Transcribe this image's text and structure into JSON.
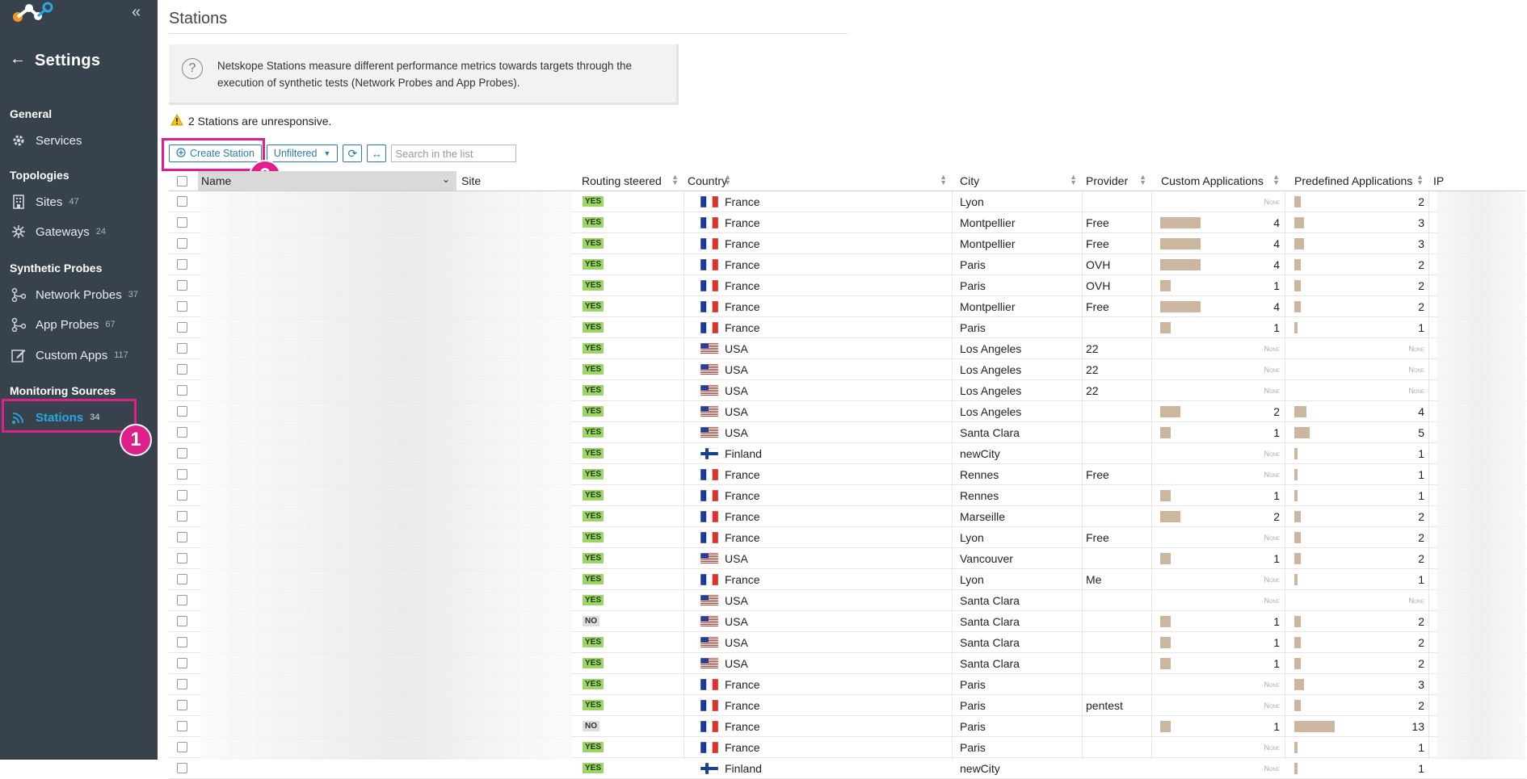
{
  "sidebar": {
    "title": "Settings",
    "sections": [
      {
        "label": "General"
      },
      {
        "label": "Topologies"
      },
      {
        "label": "Synthetic Probes"
      },
      {
        "label": "Monitoring Sources"
      }
    ],
    "items": [
      {
        "label": "Services",
        "count": "",
        "icon": "gear-icon"
      },
      {
        "label": "Sites",
        "count": "47",
        "icon": "building-icon"
      },
      {
        "label": "Gateways",
        "count": "24",
        "icon": "gateway-icon"
      },
      {
        "label": "Network Probes",
        "count": "37",
        "icon": "network-icon"
      },
      {
        "label": "App Probes",
        "count": "67",
        "icon": "network-icon"
      },
      {
        "label": "Custom Apps",
        "count": "117",
        "icon": "edit-icon"
      },
      {
        "label": "Stations",
        "count": "34",
        "icon": "wifi-icon"
      }
    ],
    "annotation_1": "1"
  },
  "page": {
    "title": "Stations",
    "info": "Netskope Stations measure different performance metrics towards targets through the execution of synthetic tests (Network Probes and App Probes).",
    "warning": "2 Stations are unresponsive."
  },
  "toolbar": {
    "create_label": "Create Station",
    "filter_label": "Unfiltered",
    "search_placeholder": "Search in the list",
    "annotation_2": "2"
  },
  "table": {
    "columns": [
      "Name",
      "Site",
      "Routing steered",
      "Country",
      "City",
      "Provider",
      "Custom Applications",
      "Predefined Applications",
      "IP"
    ],
    "none_label": "None",
    "rows": [
      {
        "routing": "YES",
        "country": "France",
        "city": "Lyon",
        "provider": "",
        "custom": null,
        "predefined": 2
      },
      {
        "routing": "YES",
        "country": "France",
        "city": "Montpellier",
        "provider": "Free",
        "custom": 4,
        "predefined": 3
      },
      {
        "routing": "YES",
        "country": "France",
        "city": "Montpellier",
        "provider": "Free",
        "custom": 4,
        "predefined": 3
      },
      {
        "routing": "YES",
        "country": "France",
        "city": "Paris",
        "provider": "OVH",
        "custom": 4,
        "predefined": 2
      },
      {
        "routing": "YES",
        "country": "France",
        "city": "Paris",
        "provider": "OVH",
        "custom": 1,
        "predefined": 2
      },
      {
        "routing": "YES",
        "country": "France",
        "city": "Montpellier",
        "provider": "Free",
        "custom": 4,
        "predefined": 2
      },
      {
        "routing": "YES",
        "country": "France",
        "city": "Paris",
        "provider": "",
        "custom": 1,
        "predefined": 1
      },
      {
        "routing": "YES",
        "country": "USA",
        "city": "Los Angeles",
        "provider": "22",
        "custom": null,
        "predefined": null
      },
      {
        "routing": "YES",
        "country": "USA",
        "city": "Los Angeles",
        "provider": "22",
        "custom": null,
        "predefined": null
      },
      {
        "routing": "YES",
        "country": "USA",
        "city": "Los Angeles",
        "provider": "22",
        "custom": null,
        "predefined": null
      },
      {
        "routing": "YES",
        "country": "USA",
        "city": "Los Angeles",
        "provider": "",
        "custom": 2,
        "predefined": 4
      },
      {
        "routing": "YES",
        "country": "USA",
        "city": "Santa Clara",
        "provider": "",
        "custom": 1,
        "predefined": 5
      },
      {
        "routing": "YES",
        "country": "Finland",
        "city": "newCity",
        "provider": "",
        "custom": null,
        "predefined": 1
      },
      {
        "routing": "YES",
        "country": "France",
        "city": "Rennes",
        "provider": "Free",
        "custom": null,
        "predefined": 1
      },
      {
        "routing": "YES",
        "country": "France",
        "city": "Rennes",
        "provider": "",
        "custom": 1,
        "predefined": 1
      },
      {
        "routing": "YES",
        "country": "France",
        "city": "Marseille",
        "provider": "",
        "custom": 2,
        "predefined": 2
      },
      {
        "routing": "YES",
        "country": "France",
        "city": "Lyon",
        "provider": "Free",
        "custom": null,
        "predefined": 2
      },
      {
        "routing": "YES",
        "country": "USA",
        "city": "Vancouver",
        "provider": "",
        "custom": 1,
        "predefined": 2
      },
      {
        "routing": "YES",
        "country": "France",
        "city": "Lyon",
        "provider": "Me",
        "custom": null,
        "predefined": 1
      },
      {
        "routing": "YES",
        "country": "USA",
        "city": "Santa Clara",
        "provider": "",
        "custom": null,
        "predefined": null
      },
      {
        "routing": "NO",
        "country": "USA",
        "city": "Santa Clara",
        "provider": "",
        "custom": 1,
        "predefined": 2
      },
      {
        "routing": "YES",
        "country": "USA",
        "city": "Santa Clara",
        "provider": "",
        "custom": 1,
        "predefined": 2
      },
      {
        "routing": "YES",
        "country": "USA",
        "city": "Santa Clara",
        "provider": "",
        "custom": 1,
        "predefined": 2
      },
      {
        "routing": "YES",
        "country": "France",
        "city": "Paris",
        "provider": "",
        "custom": null,
        "predefined": 3
      },
      {
        "routing": "YES",
        "country": "France",
        "city": "Paris",
        "provider": "pentest",
        "custom": null,
        "predefined": 2
      },
      {
        "routing": "NO",
        "country": "France",
        "city": "Paris",
        "provider": "",
        "custom": 1,
        "predefined": 13
      },
      {
        "routing": "YES",
        "country": "France",
        "city": "Paris",
        "provider": "",
        "custom": null,
        "predefined": 1
      },
      {
        "routing": "YES",
        "country": "Finland",
        "city": "newCity",
        "provider": "",
        "custom": null,
        "predefined": 1
      }
    ]
  },
  "colors": {
    "sidebar_bg": "#37424d",
    "accent": "#29a8e0",
    "highlight": "#e0208a",
    "yes_badge": "#9ed36a",
    "bar": "#cbb79f"
  }
}
